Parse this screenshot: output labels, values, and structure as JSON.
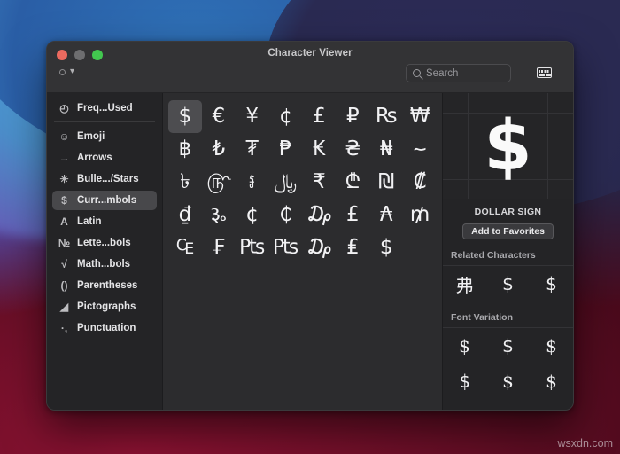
{
  "window": {
    "title": "Character Viewer",
    "traffic_lights": [
      "close",
      "minimize",
      "zoom"
    ]
  },
  "toolbar": {
    "search_placeholder": "Search",
    "search_value": "",
    "keyboard_button": "keyboard-icon"
  },
  "sidebar": {
    "items": [
      {
        "label": "Freq...Used",
        "icon": "clock-icon",
        "selected": false
      },
      {
        "label": "Emoji",
        "icon": "smiley-icon",
        "selected": false
      },
      {
        "label": "Arrows",
        "icon": "arrow-right-icon",
        "selected": false
      },
      {
        "label": "Bulle.../Stars",
        "icon": "asterisk-icon",
        "selected": false
      },
      {
        "label": "Curr...mbols",
        "icon": "dollar-icon",
        "selected": true
      },
      {
        "label": "Latin",
        "icon": "letter-a-icon",
        "selected": false
      },
      {
        "label": "Lette...bols",
        "icon": "numero-icon",
        "selected": false
      },
      {
        "label": "Math...bols",
        "icon": "radical-icon",
        "selected": false
      },
      {
        "label": "Parentheses",
        "icon": "parentheses-icon",
        "selected": false
      },
      {
        "label": "Pictographs",
        "icon": "pictograph-icon",
        "selected": false
      },
      {
        "label": "Punctuation",
        "icon": "punctuation-icon",
        "selected": false
      }
    ],
    "icon_glyphs": [
      "◴",
      "☺",
      "→",
      "✳",
      "＄",
      "A",
      "№",
      "√",
      "()",
      "◢",
      "·,"
    ]
  },
  "grid": {
    "selected_index": 0,
    "characters": [
      "$",
      "€",
      "¥",
      "¢",
      "£",
      "₽",
      "₨",
      "₩",
      "฿",
      "₺",
      "₮",
      "₱",
      "₭",
      "₴",
      "₦",
      "؅",
      "৳",
      "௹",
      "៛",
      "﷼",
      "₹",
      "₾",
      "₪",
      "₡",
      "₫",
      "૱",
      "¢",
      "₵",
      "₯",
      "£",
      "₳",
      "₥",
      "₠",
      "₣",
      "₧",
      "₧",
      "₯",
      "₤",
      "$"
    ]
  },
  "detail": {
    "big_character": "$",
    "character_name": "DOLLAR SIGN",
    "favorites_button": "Add to Favorites",
    "related_title": "Related Characters",
    "related_characters": [
      "弗",
      "$",
      "$"
    ],
    "font_variation_title": "Font Variation",
    "font_variations": [
      "$",
      "$",
      "$",
      "$",
      "$",
      "$"
    ]
  },
  "watermark": {
    "text": "wsxdn.com"
  },
  "colors": {
    "window_bg": "#2c2c2e",
    "sidebar_bg": "#242426",
    "titlebar_bg": "#333335",
    "selection": "#4d4d50",
    "text": "#e4e4e6",
    "muted_text": "#a9a9ad",
    "light_red": "#ec6a5f",
    "light_yellow": "#6e6e70",
    "light_green": "#42c74f"
  }
}
